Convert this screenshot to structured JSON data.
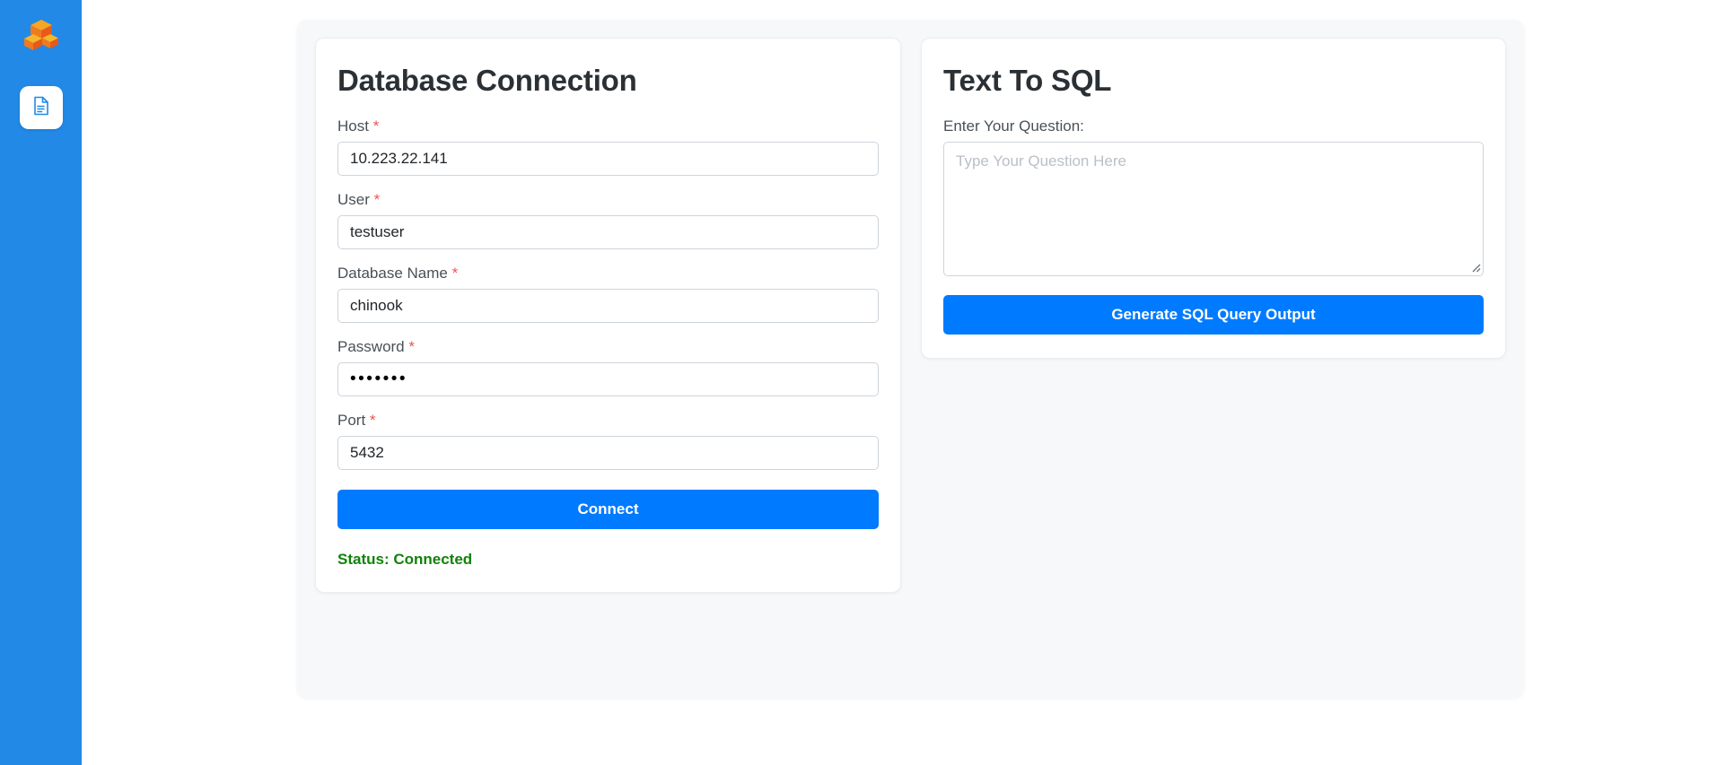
{
  "sidebar": {
    "logo_icon": "stacked-boxes-logo",
    "nav_items": [
      {
        "icon": "document-file-icon",
        "label": "",
        "active": true
      }
    ]
  },
  "db_panel": {
    "title": "Database Connection",
    "required_marker": "*",
    "fields": [
      {
        "label": "Host",
        "value": "10.223.22.141",
        "required": true,
        "type": "text"
      },
      {
        "label": "User",
        "value": "testuser",
        "required": true,
        "type": "text"
      },
      {
        "label": "Database Name",
        "value": "chinook",
        "required": true,
        "type": "text"
      },
      {
        "label": "Password",
        "value": "•••••••",
        "required": true,
        "type": "password"
      },
      {
        "label": "Port",
        "value": "5432",
        "required": true,
        "type": "text"
      }
    ],
    "connect_label": "Connect",
    "status_text": "Status: Connected",
    "status_color": "#11820a"
  },
  "sql_panel": {
    "title": "Text To SQL",
    "question_label": "Enter Your Question:",
    "question_value": "",
    "question_placeholder": "Type Your Question Here",
    "generate_label": "Generate SQL Query Output"
  },
  "colors": {
    "sidebar_blue": "#2289e6",
    "primary_blue": "#007bff",
    "required_red": "#ef5350",
    "status_green": "#11820a",
    "shell_gray": "#f7f8f9"
  }
}
